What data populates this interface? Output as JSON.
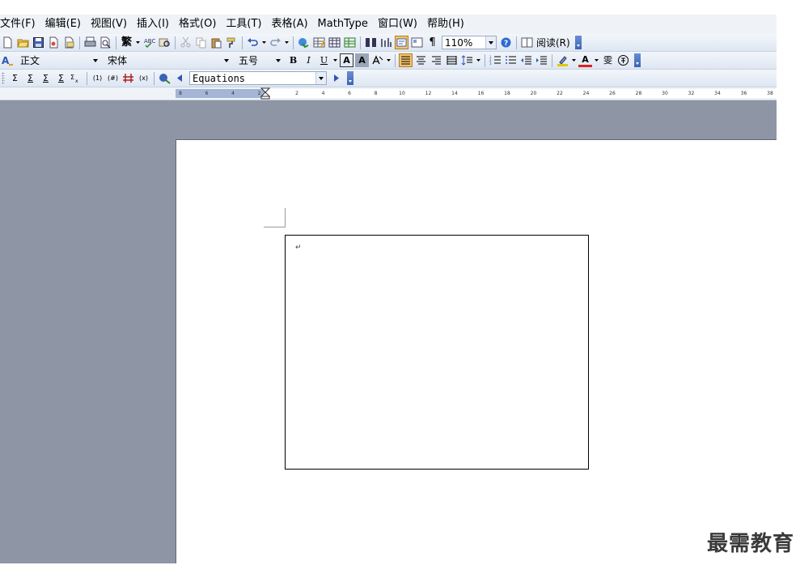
{
  "menu": {
    "items": [
      "文件(F)",
      "编辑(E)",
      "视图(V)",
      "插入(I)",
      "格式(O)",
      "工具(T)",
      "表格(A)",
      "MathType",
      "窗口(W)",
      "帮助(H)"
    ]
  },
  "standard_toolbar": {
    "traditional_label": "繁",
    "zoom_value": "110%",
    "reading_label": "阅读(R)"
  },
  "format_toolbar": {
    "style_value": "正文",
    "font_value": "宋体",
    "size_value": "五号",
    "bold": "B",
    "italic": "I",
    "underline": "U",
    "char_border": "A",
    "char_shade": "A",
    "font_color": "A",
    "phonetic": "雯"
  },
  "math_toolbar": {
    "sum_labels": [
      "Σ",
      "Σ",
      "Σ",
      "Σ"
    ],
    "numbering": "(1)",
    "numbering2": "(#)",
    "equations_value": "Equations"
  },
  "ruler": {
    "labels": [
      "8",
      "6",
      "4",
      "2",
      "2",
      "4",
      "6",
      "8",
      "10",
      "12",
      "14",
      "16",
      "18",
      "20",
      "22",
      "24",
      "26",
      "28",
      "30",
      "32",
      "34",
      "36",
      "38"
    ]
  },
  "document": {
    "paragraph_mark": "↵"
  },
  "watermark": "最需教育",
  "colors": {
    "workspace": "#8e96a6",
    "toolbar_top": "#f3f6fb",
    "toolbar_bottom": "#dde6f2",
    "ruler_margin": "#a4b5d6"
  }
}
